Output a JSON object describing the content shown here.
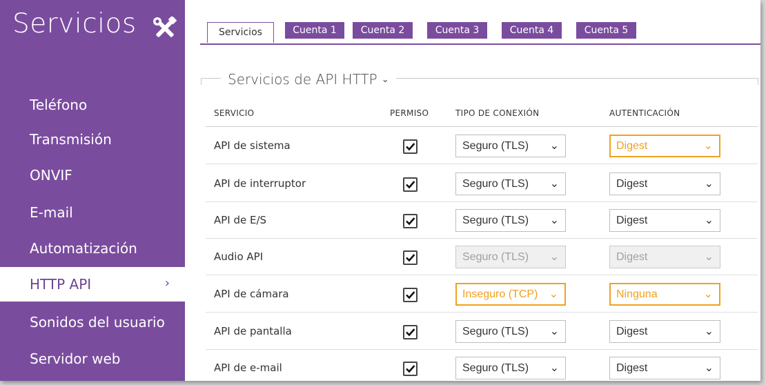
{
  "sidebar": {
    "title": "Servicios",
    "title_icon": "tools-icon",
    "items": [
      {
        "label": "Teléfono"
      },
      {
        "label": "Transmisión"
      },
      {
        "label": "ONVIF"
      },
      {
        "label": "E-mail"
      },
      {
        "label": "Automatización"
      },
      {
        "label": "HTTP API",
        "active": true,
        "chevron": "›"
      },
      {
        "label": "Sonidos del usuario"
      },
      {
        "label": "Servidor web"
      }
    ]
  },
  "tabs": [
    {
      "label": "Servicios",
      "active": true
    },
    {
      "label": "Cuenta 1"
    },
    {
      "label": "Cuenta 2"
    },
    {
      "label": "Cuenta 3"
    },
    {
      "label": "Cuenta 4"
    },
    {
      "label": "Cuenta 5"
    }
  ],
  "section": {
    "title": "Servicios de API HTTP",
    "title_chevron": "⌄",
    "columns": {
      "service": "SERVICIO",
      "permission": "PERMISO",
      "connection": "TIPO DE CONEXIÓN",
      "auth": "AUTENTICACIÓN"
    },
    "rows": [
      {
        "name": "API de sistema",
        "checked": true,
        "connection": "Seguro (TLS)",
        "auth": "Digest",
        "auth_state": "warning"
      },
      {
        "name": "API de interruptor",
        "checked": true,
        "connection": "Seguro (TLS)",
        "auth": "Digest"
      },
      {
        "name": "API de E/S",
        "checked": true,
        "connection": "Seguro (TLS)",
        "auth": "Digest"
      },
      {
        "name": "Audio API",
        "checked": true,
        "connection": "Seguro (TLS)",
        "auth": "Digest",
        "disabled": true
      },
      {
        "name": "API de cámara",
        "checked": true,
        "connection": "Inseguro (TCP)",
        "auth": "Ninguna",
        "connection_state": "warning",
        "auth_state": "warning"
      },
      {
        "name": "API de pantalla",
        "checked": true,
        "connection": "Seguro (TLS)",
        "auth": "Digest"
      },
      {
        "name": "API de e-mail",
        "checked": true,
        "connection": "Seguro (TLS)",
        "auth": "Digest"
      }
    ]
  },
  "colors": {
    "brand": "#7a4c9e",
    "warning": "#f0a020"
  }
}
